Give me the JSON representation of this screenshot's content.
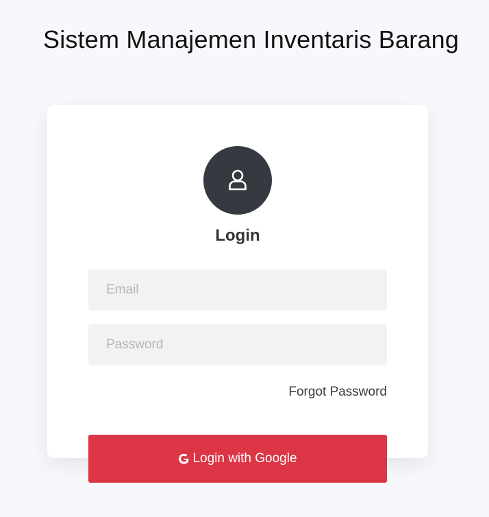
{
  "header": {
    "title": "Sistem Manajemen Inventaris Barang"
  },
  "login_card": {
    "avatar_icon": "user-icon",
    "heading": "Login",
    "email_field": {
      "placeholder": "Email",
      "value": ""
    },
    "password_field": {
      "placeholder": "Password",
      "value": ""
    },
    "forgot_password_label": "Forgot Password",
    "google_button": {
      "icon": "google-icon",
      "label": "Login with Google"
    }
  },
  "colors": {
    "page_background": "#f7f8fc",
    "card_background": "#ffffff",
    "avatar_background": "#343a40",
    "input_background": "#f2f2f2",
    "primary_button": "#dc3545",
    "text_dark": "#333333"
  }
}
